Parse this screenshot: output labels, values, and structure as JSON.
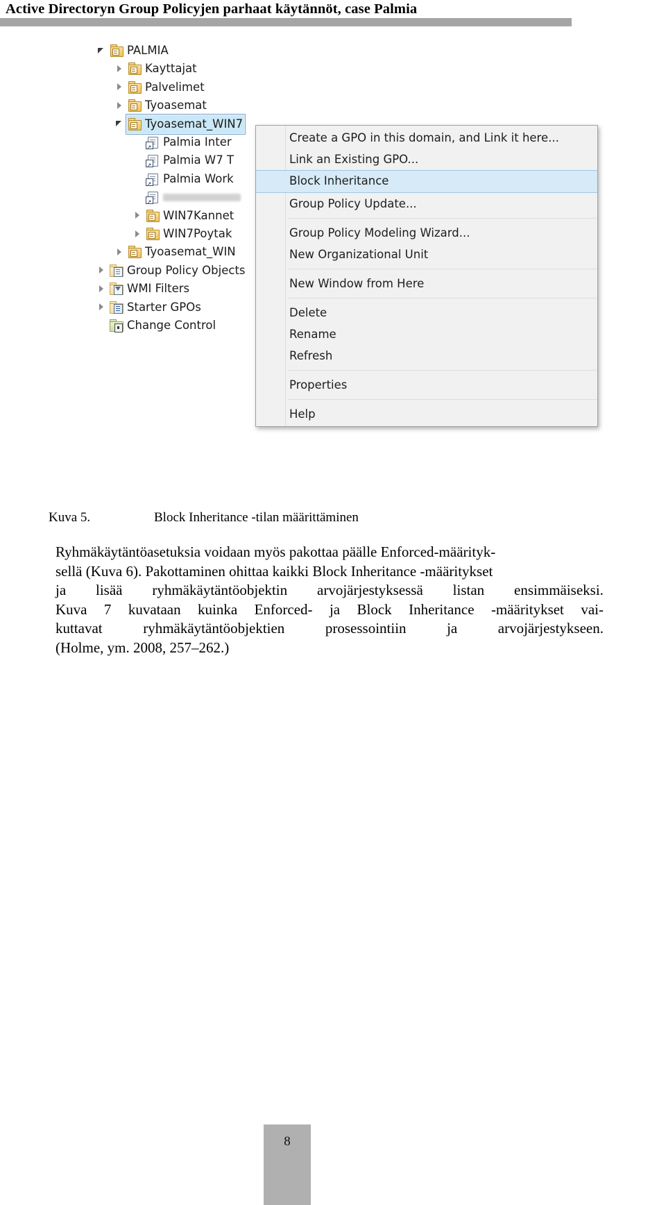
{
  "header": {
    "title": "Active Directoryn Group Policyjen parhaat käytännöt, case Palmia"
  },
  "figure": {
    "tree": {
      "items": [
        {
          "label": "PALMIA",
          "icon": "ou-folder-icon",
          "indent": 0,
          "expander": "expanded",
          "selected": false,
          "redacted": false
        },
        {
          "label": "Kayttajat",
          "icon": "ou-folder-icon",
          "indent": 1,
          "expander": "collapsed",
          "selected": false,
          "redacted": false
        },
        {
          "label": "Palvelimet",
          "icon": "ou-folder-icon",
          "indent": 1,
          "expander": "collapsed",
          "selected": false,
          "redacted": false
        },
        {
          "label": "Tyoasemat",
          "icon": "ou-folder-icon",
          "indent": 1,
          "expander": "collapsed",
          "selected": false,
          "redacted": false
        },
        {
          "label": "Tyoasemat_WIN7",
          "icon": "ou-folder-icon",
          "indent": 1,
          "expander": "expanded",
          "selected": true,
          "redacted": false
        },
        {
          "label": "Palmia Inter",
          "icon": "gpo-link-icon",
          "indent": 2,
          "expander": "none",
          "selected": false,
          "redacted": false
        },
        {
          "label": "Palmia W7 T",
          "icon": "gpo-link-icon",
          "indent": 2,
          "expander": "none",
          "selected": false,
          "redacted": false
        },
        {
          "label": "Palmia Work",
          "icon": "gpo-link-icon",
          "indent": 2,
          "expander": "none",
          "selected": false,
          "redacted": false
        },
        {
          "label": "",
          "icon": "gpo-link-icon",
          "indent": 2,
          "expander": "none",
          "selected": false,
          "redacted": true
        },
        {
          "label": "WIN7Kannet",
          "icon": "ou-folder-icon",
          "indent": 2,
          "expander": "collapsed",
          "selected": false,
          "redacted": false
        },
        {
          "label": "WIN7Poytak",
          "icon": "ou-folder-icon",
          "indent": 2,
          "expander": "collapsed",
          "selected": false,
          "redacted": false
        },
        {
          "label": "Tyoasemat_WIN",
          "icon": "ou-folder-icon",
          "indent": 1,
          "expander": "collapsed",
          "selected": false,
          "redacted": false
        },
        {
          "label": "Group Policy Objects",
          "icon": "gpo-container-icon",
          "indent": 0,
          "expander": "collapsed",
          "selected": false,
          "redacted": false
        },
        {
          "label": "WMI Filters",
          "icon": "wmi-filter-folder-icon",
          "indent": 0,
          "expander": "collapsed",
          "selected": false,
          "redacted": false
        },
        {
          "label": "Starter GPOs",
          "icon": "starter-gpo-folder-icon",
          "indent": 0,
          "expander": "collapsed",
          "selected": false,
          "redacted": false
        },
        {
          "label": "Change Control",
          "icon": "change-control-folder-icon",
          "indent": 0,
          "expander": "none",
          "selected": false,
          "redacted": false
        }
      ]
    },
    "context_menu": {
      "items": [
        {
          "label": "Create a GPO in this domain, and Link it here...",
          "highlight": false,
          "separator_after": false
        },
        {
          "label": "Link an Existing GPO...",
          "highlight": false,
          "separator_after": false
        },
        {
          "label": "Block Inheritance",
          "highlight": true,
          "separator_after": false
        },
        {
          "label": "Group Policy Update...",
          "highlight": false,
          "separator_after": true
        },
        {
          "label": "Group Policy Modeling Wizard...",
          "highlight": false,
          "separator_after": false
        },
        {
          "label": "New Organizational Unit",
          "highlight": false,
          "separator_after": true
        },
        {
          "label": "New Window from Here",
          "highlight": false,
          "separator_after": true
        },
        {
          "label": "Delete",
          "highlight": false,
          "separator_after": false
        },
        {
          "label": "Rename",
          "highlight": false,
          "separator_after": false
        },
        {
          "label": "Refresh",
          "highlight": false,
          "separator_after": true
        },
        {
          "label": "Properties",
          "highlight": false,
          "separator_after": true
        },
        {
          "label": "Help",
          "highlight": false,
          "separator_after": false
        }
      ]
    },
    "caption": {
      "number": "Kuva 5.",
      "text": "Block Inheritance -tilan määrittäminen"
    }
  },
  "body": {
    "lines": [
      {
        "text": "Ryhmäkäytäntöasetuksia voidaan myös pakottaa päälle Enforced-määrityk-",
        "justified": false
      },
      {
        "text": "sellä (Kuva 6). Pakottaminen ohittaa kaikki Block Inheritance -määritykset",
        "justified": false
      },
      {
        "words": [
          "ja",
          "lisää",
          "ryhmäkäytäntöobjektin",
          "arvojärjestyksessä",
          "listan",
          "ensimmäiseksi."
        ],
        "justified": true
      },
      {
        "words": [
          "Kuva",
          "7",
          "kuvataan",
          "kuinka",
          "Enforced-",
          "ja",
          "Block",
          "Inheritance",
          "-määritykset",
          "vai-"
        ],
        "justified": true
      },
      {
        "words": [
          "kuttavat",
          "ryhmäkäytäntöobjektien",
          "prosessointiin",
          "ja",
          "arvojärjestykseen."
        ],
        "justified": true
      },
      {
        "text": "(Holme, ym. 2008, 257–262.)",
        "justified": false
      }
    ]
  },
  "footer": {
    "page_number": "8"
  }
}
